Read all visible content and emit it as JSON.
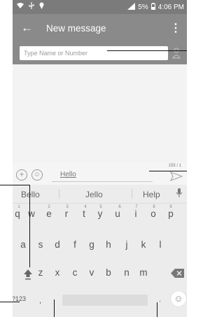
{
  "status_bar": {
    "battery": "5%",
    "time": "4:06 PM"
  },
  "app_bar": {
    "title": "New message",
    "back_icon": "arrow-back-icon",
    "menu_icon": "more-vert-icon"
  },
  "recipient": {
    "placeholder": "Type Name or Number"
  },
  "composer": {
    "text": "Hello",
    "counter": "155 / 1"
  },
  "keyboard": {
    "suggestions": [
      "Bello",
      "Jello",
      "Help"
    ],
    "row1": [
      "q",
      "w",
      "e",
      "r",
      "t",
      "y",
      "u",
      "i",
      "o",
      "p"
    ],
    "row1_numbers": [
      "1",
      "2",
      "3",
      "4",
      "5",
      "6",
      "7",
      "8",
      "9"
    ],
    "row2": [
      "a",
      "s",
      "d",
      "f",
      "g",
      "h",
      "j",
      "k",
      "l"
    ],
    "row3": [
      "z",
      "x",
      "c",
      "v",
      "b",
      "n",
      "m"
    ],
    "symbols_label": "?123",
    "comma": ",",
    "period": "."
  },
  "colors": {
    "app_bar": "#8a8a8a",
    "status_bar": "#7b7b7b",
    "background": "#f2f2f2"
  }
}
